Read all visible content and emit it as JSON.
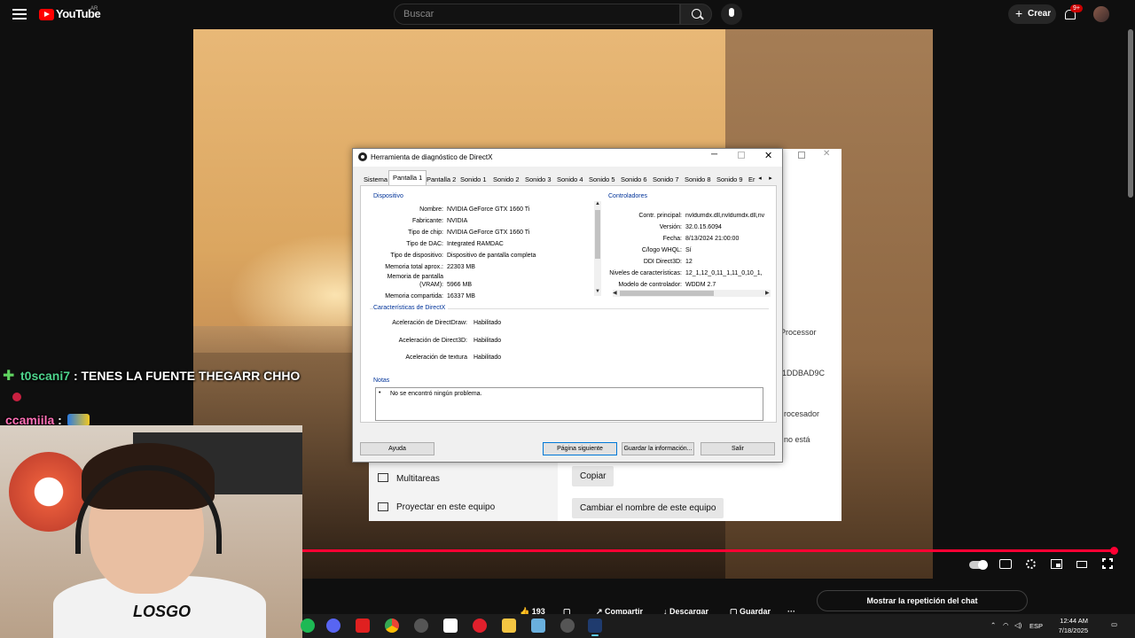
{
  "youtube": {
    "logo_text": "YouTube",
    "country": "AR",
    "search_placeholder": "Buscar",
    "create_label": "Crear",
    "notif_count": "9+",
    "actions": {
      "likes": "193",
      "share": "Compartir",
      "download": "Descargar",
      "save": "Guardar",
      "more": "···"
    },
    "chat_replay": "Mostrar la repetición del chat",
    "progress": 1.0
  },
  "chat": [
    {
      "user": "t0scani7",
      "message": "TENES LA FUENTE THEGARR CHHO"
    },
    {
      "user": "ccamiila",
      "message": ""
    }
  ],
  "webcam": {
    "shirt_text": "LOSGO"
  },
  "settings_window": {
    "nav": [
      "Multitareas",
      "Proyectar en este equipo"
    ],
    "copy_button": "Copiar",
    "rename_button": "Cambiar el nombre de este equipo",
    "text_fragments": [
      "Processor",
      "1DDBAD9C",
      "rocesador",
      "no está"
    ]
  },
  "dxdiag": {
    "title": "Herramienta de diagnóstico de DirectX",
    "tabs": [
      "Sistema",
      "Pantalla 1",
      "Pantalla 2",
      "Sonido 1",
      "Sonido 2",
      "Sonido 3",
      "Sonido 4",
      "Sonido 5",
      "Sonido 6",
      "Sonido 7",
      "Sonido 8",
      "Sonido 9",
      "Er"
    ],
    "active_tab": "Pantalla 1",
    "device_title": "Dispositivo",
    "device": [
      {
        "label": "Nombre:",
        "value": "NVIDIA GeForce GTX 1660 Ti"
      },
      {
        "label": "Fabricante:",
        "value": "NVIDIA"
      },
      {
        "label": "Tipo de chip:",
        "value": "NVIDIA GeForce GTX 1660 Ti"
      },
      {
        "label": "Tipo de DAC:",
        "value": "Integrated RAMDAC"
      },
      {
        "label": "Tipo de dispositivo:",
        "value": "Dispositivo de pantalla completa"
      },
      {
        "label": "Memoria total aprox.:",
        "value": "22303 MB"
      },
      {
        "label": "Memoria de pantalla (VRAM):",
        "value": "5966 MB"
      },
      {
        "label": "Memoria compartida:",
        "value": "16337 MB"
      }
    ],
    "drivers_title": "Controladores",
    "drivers": [
      {
        "label": "Contr. principal:",
        "value": "nvldumdx.dll,nvldumdx.dll,nv"
      },
      {
        "label": "Versión:",
        "value": "32.0.15.6094"
      },
      {
        "label": "Fecha:",
        "value": "8/13/2024 21:00:00"
      },
      {
        "label": "C/logo WHQL:",
        "value": "Sí"
      },
      {
        "label": "DDI Direct3D:",
        "value": "12"
      },
      {
        "label": "Niveles de características:",
        "value": "12_1,12_0,11_1,11_0,10_1,"
      },
      {
        "label": "Modelo de controlador:",
        "value": "WDDM 2.7"
      }
    ],
    "features_title": "Características de DirectX",
    "features": [
      {
        "label": "Aceleración de DirectDraw:",
        "value": "Habilitado"
      },
      {
        "label": "Aceleración de Direct3D:",
        "value": "Habilitado"
      },
      {
        "label": "Aceleración de textura",
        "value": "Habilitado"
      }
    ],
    "notes_title": "Notas",
    "notes": [
      "No se encontró ningún problema."
    ],
    "buttons": {
      "help": "Ayuda",
      "next": "Página siguiente",
      "save_info": "Guardar la información...",
      "exit": "Salir"
    }
  },
  "taskbar": {
    "language": "ESP",
    "time": "12:44 AM",
    "date": "7/18/2025"
  }
}
